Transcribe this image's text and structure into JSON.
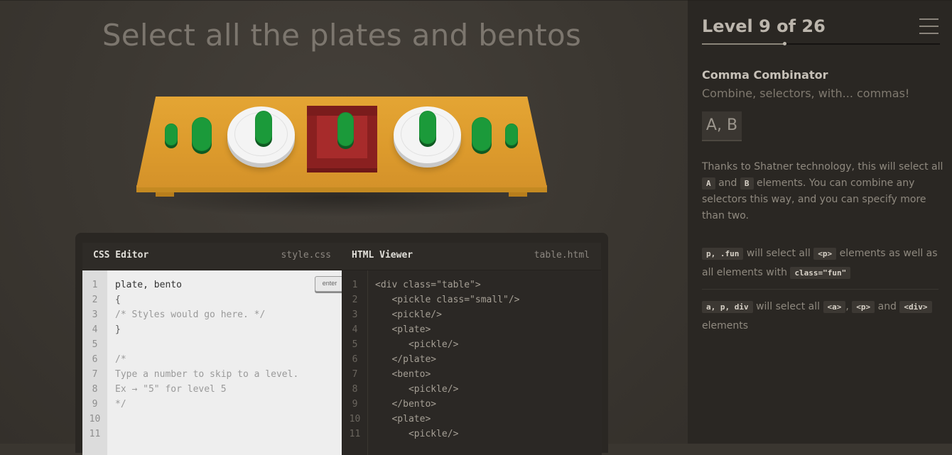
{
  "game": {
    "title": "Select all the plates and bentos"
  },
  "editor": {
    "css_header": "CSS Editor",
    "css_file": "style.css",
    "html_header": "HTML Viewer",
    "html_file": "table.html",
    "enter_label": "enter",
    "css_lines": [
      "plate, bento",
      "{",
      "/* Styles would go here. */",
      "}",
      "",
      "/*",
      "Type a number to skip to a level.",
      "Ex → \"5\" for level 5",
      "*/",
      "",
      ""
    ],
    "css_line_numbers": [
      "1",
      "2",
      "3",
      "4",
      "5",
      "6",
      "7",
      "8",
      "9",
      "10",
      "11"
    ],
    "html_lines": [
      "<div class=\"table\">",
      "   <pickle class=\"small\"/>",
      "   <pickle/>",
      "   <plate>",
      "      <pickle/>",
      "   </plate>",
      "   <bento>",
      "      <pickle/>",
      "   </bento>",
      "   <plate>",
      "      <pickle/>"
    ],
    "html_line_numbers": [
      "1",
      "2",
      "3",
      "4",
      "5",
      "6",
      "7",
      "8",
      "9",
      "10",
      "11"
    ]
  },
  "sidebar": {
    "level_title": "Level 9 of 26",
    "level_current": 9,
    "level_total": 26,
    "lesson_name": "Comma Combinator",
    "lesson_sub": "Combine, selectors, with... commas!",
    "selector": "A, B",
    "desc_1": "Thanks to Shatner technology, this will select all",
    "desc_a": "A",
    "desc_2": "and",
    "desc_b": "B",
    "desc_3": "elements. You can combine any selectors this way, and you can specify more than two.",
    "ex1_code": "p, .fun",
    "ex1_text1": "will select all",
    "ex1_tag": "<p>",
    "ex1_text2": "elements as well as all elements with",
    "ex1_code2": "class=\"fun\"",
    "ex2_code": "a, p, div",
    "ex2_text1": "will select all",
    "ex2_tag1": "<a>",
    "ex2_comma": ",",
    "ex2_tag2": "<p>",
    "ex2_text2": "and",
    "ex2_tag3": "<div>",
    "ex2_text3": "elements"
  },
  "colors": {
    "table": "#dc9a2c",
    "pickle": "#1b9a3a",
    "plate": "#f4f4f4",
    "bento": "#a72b2b"
  }
}
